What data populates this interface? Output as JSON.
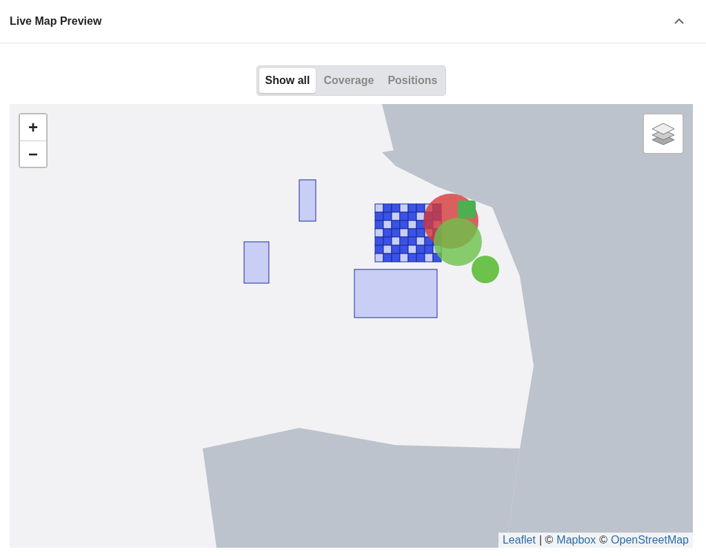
{
  "panel": {
    "title": "Live Map Preview",
    "expanded": true
  },
  "tabs": [
    {
      "label": "Show all",
      "selected": true
    },
    {
      "label": "Coverage",
      "selected": false
    },
    {
      "label": "Positions",
      "selected": false
    }
  ],
  "map": {
    "zoom_in": "+",
    "zoom_out": "−",
    "attribution": [
      {
        "kind": "link",
        "text": "Leaflet"
      },
      {
        "kind": "text",
        "text": "| ©"
      },
      {
        "kind": "link",
        "text": "Mapbox"
      },
      {
        "kind": "text",
        "text": "©"
      },
      {
        "kind": "link",
        "text": "OpenStreetMap"
      }
    ]
  }
}
